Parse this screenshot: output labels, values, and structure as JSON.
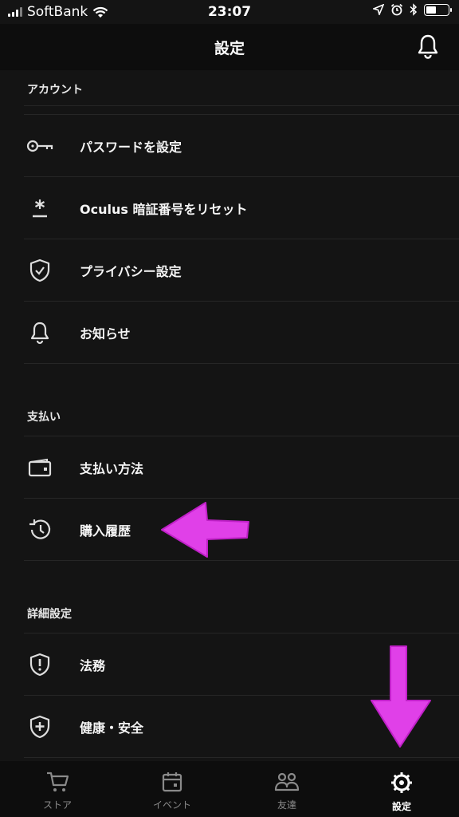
{
  "status_bar": {
    "carrier": "SoftBank",
    "time": "23:07"
  },
  "nav": {
    "title": "設定",
    "bell_icon": "bell-icon"
  },
  "sections": {
    "account": {
      "header": "アカウント",
      "items": [
        {
          "label": "パスワードを設定",
          "icon": "key-icon"
        },
        {
          "label": "Oculus 暗証番号をリセット",
          "icon": "asterisk-icon"
        },
        {
          "label": "プライバシー設定",
          "icon": "shield-check-icon"
        },
        {
          "label": "お知らせ",
          "icon": "bell-icon"
        }
      ]
    },
    "payment": {
      "header": "支払い",
      "items": [
        {
          "label": "支払い方法",
          "icon": "wallet-icon"
        },
        {
          "label": "購入履歴",
          "icon": "history-icon"
        }
      ]
    },
    "advanced": {
      "header": "詳細設定",
      "items": [
        {
          "label": "法務",
          "icon": "shield-alert-icon"
        },
        {
          "label": "健康・安全",
          "icon": "shield-plus-icon"
        }
      ]
    }
  },
  "tab_bar": {
    "tabs": [
      {
        "label": "ストア",
        "icon": "cart-icon",
        "active": false
      },
      {
        "label": "イベント",
        "icon": "calendar-icon",
        "active": false
      },
      {
        "label": "友達",
        "icon": "friends-icon",
        "active": false
      },
      {
        "label": "設定",
        "icon": "gear-icon",
        "active": true
      }
    ]
  },
  "colors": {
    "background": "#141414",
    "nav_background": "#0d0d0d",
    "annotation_magenta": "#e040e8"
  }
}
